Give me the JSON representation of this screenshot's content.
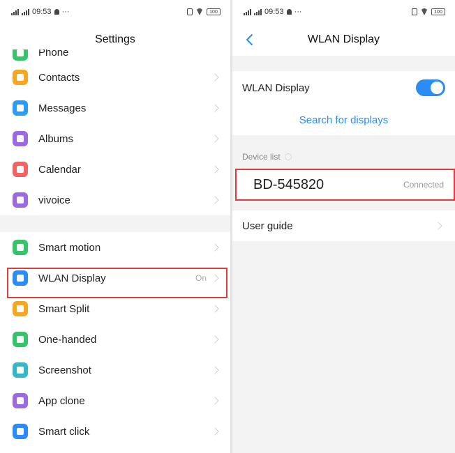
{
  "status": {
    "time": "09:53",
    "battery": "100"
  },
  "left": {
    "title": "Settings",
    "partial_item": "Phone",
    "group1": [
      {
        "label": "Contacts",
        "icon": "contacts-icon",
        "color": "#f5a623"
      },
      {
        "label": "Messages",
        "icon": "messages-icon",
        "color": "#2c9bf0"
      },
      {
        "label": "Albums",
        "icon": "albums-icon",
        "color": "#9b6ae0"
      },
      {
        "label": "Calendar",
        "icon": "calendar-icon",
        "color": "#f06464"
      },
      {
        "label": "vivoice",
        "icon": "mic-icon",
        "color": "#9b6ae0"
      }
    ],
    "group2": [
      {
        "label": "Smart motion",
        "icon": "smart-motion-icon",
        "color": "#36c46a"
      },
      {
        "label": "WLAN Display",
        "icon": "wlan-display-icon",
        "color": "#2c8cf5",
        "value": "On"
      },
      {
        "label": "Smart Split",
        "icon": "smart-split-icon",
        "color": "#f5a623"
      },
      {
        "label": "One-handed",
        "icon": "one-handed-icon",
        "color": "#36c46a"
      },
      {
        "label": "Screenshot",
        "icon": "screenshot-icon",
        "color": "#33b7c9"
      },
      {
        "label": "App clone",
        "icon": "app-clone-icon",
        "color": "#9b6ae0"
      },
      {
        "label": "Smart click",
        "icon": "smart-click-icon",
        "color": "#2c8cf5"
      }
    ]
  },
  "right": {
    "title": "WLAN Display",
    "toggle_label": "WLAN Display",
    "toggle_on": true,
    "search_link": "Search for displays",
    "device_list_header": "Device list",
    "device_name": "BD-545820",
    "device_status": "Connected",
    "user_guide": "User guide"
  },
  "colors": {
    "accent": "#2c8cf5",
    "highlight": "#e43a3a"
  }
}
